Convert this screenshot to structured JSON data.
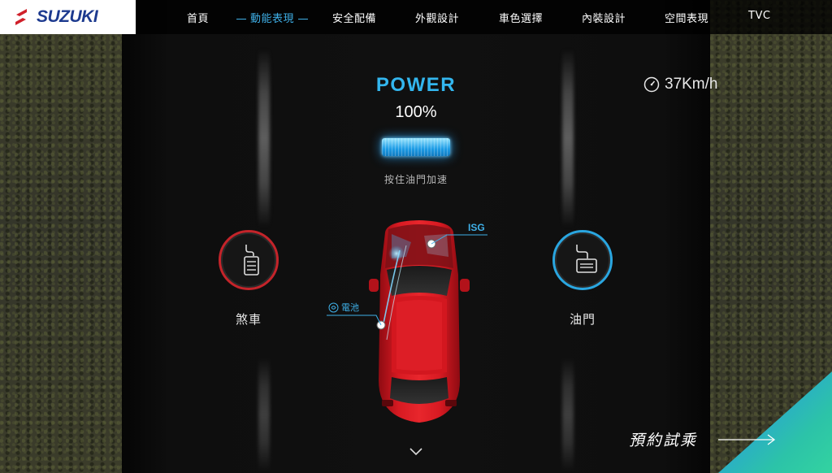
{
  "brand": {
    "name": "SUZUKI",
    "color": "#1d3a8f",
    "mark_color": "#d0202a"
  },
  "nav": {
    "items": [
      {
        "label": "首頁"
      },
      {
        "label": "動能表現",
        "active": true
      },
      {
        "label": "安全配備"
      },
      {
        "label": "外觀設計"
      },
      {
        "label": "車色選擇"
      },
      {
        "label": "內裝設計"
      },
      {
        "label": "空間表現"
      },
      {
        "label": "TVC"
      }
    ]
  },
  "power": {
    "title": "POWER",
    "value": "100%",
    "level": 1.0,
    "hint": "按住油門加速",
    "color": "#33b6ee"
  },
  "speed": {
    "icon": "speedometer-icon",
    "value": "37Km/h"
  },
  "pedals": {
    "brake": {
      "label": "煞車",
      "icon": "brake-pedal-icon",
      "ring_color": "#c4242a"
    },
    "gas": {
      "label": "油門",
      "icon": "gas-pedal-icon",
      "ring_color": "#2aa6e0"
    }
  },
  "car": {
    "callouts": {
      "isg": "ISG",
      "battery": "電池"
    },
    "body_color": "#c8141e"
  },
  "scroll": {
    "icon": "chevron-down-icon"
  },
  "cta": {
    "label": "預約試乘",
    "icon": "arrow-right-icon",
    "corner_colors": [
      "#2aa3d6",
      "#33d3a0"
    ]
  }
}
